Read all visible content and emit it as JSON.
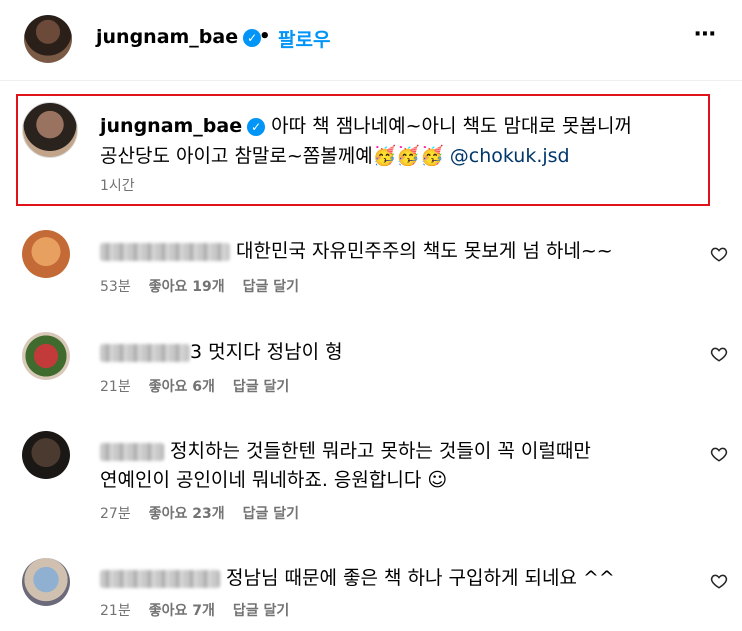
{
  "header": {
    "username": "jungnam_bae",
    "separator": "•",
    "follow_label": "팔로우",
    "more_label": "⋯"
  },
  "caption": {
    "username": "jungnam_bae",
    "line1": "아따 책 잼나네예~아니 책도 맘대로 못봅니꺼",
    "line2": "공산당도 아이고 참말로~쫌볼께예",
    "emojis": "🥳🥳🥳",
    "mention": "@chokuk.jsd",
    "time": "1시간"
  },
  "comments": [
    {
      "line1": "대한민국 자유민주주의 책도 못보게 넘 하네~~",
      "time": "53분",
      "likes": "좋아요 19개",
      "reply": "답글 달기"
    },
    {
      "line1": "3 멋지다 정남이 형",
      "time": "21분",
      "likes": "좋아요 6개",
      "reply": "답글 달기"
    },
    {
      "line1": "정치하는 것들한텐 뭐라고 못하는 것들이 꼭 이럴때만",
      "line2": "연예인이 공인이네 뭐네하죠. 응원합니다 ☺",
      "time": "27분",
      "likes": "좋아요 23개",
      "reply": "답글 달기"
    },
    {
      "line1": "정남님 때문에 좋은 책 하나 구입하게 되네요 ^^",
      "time": "21분",
      "likes": "좋아요 7개",
      "reply": "답글 달기"
    }
  ],
  "colors": {
    "accent": "#0095f6",
    "highlight_border": "#e0131a",
    "mention": "#00376b",
    "muted": "#737373"
  }
}
